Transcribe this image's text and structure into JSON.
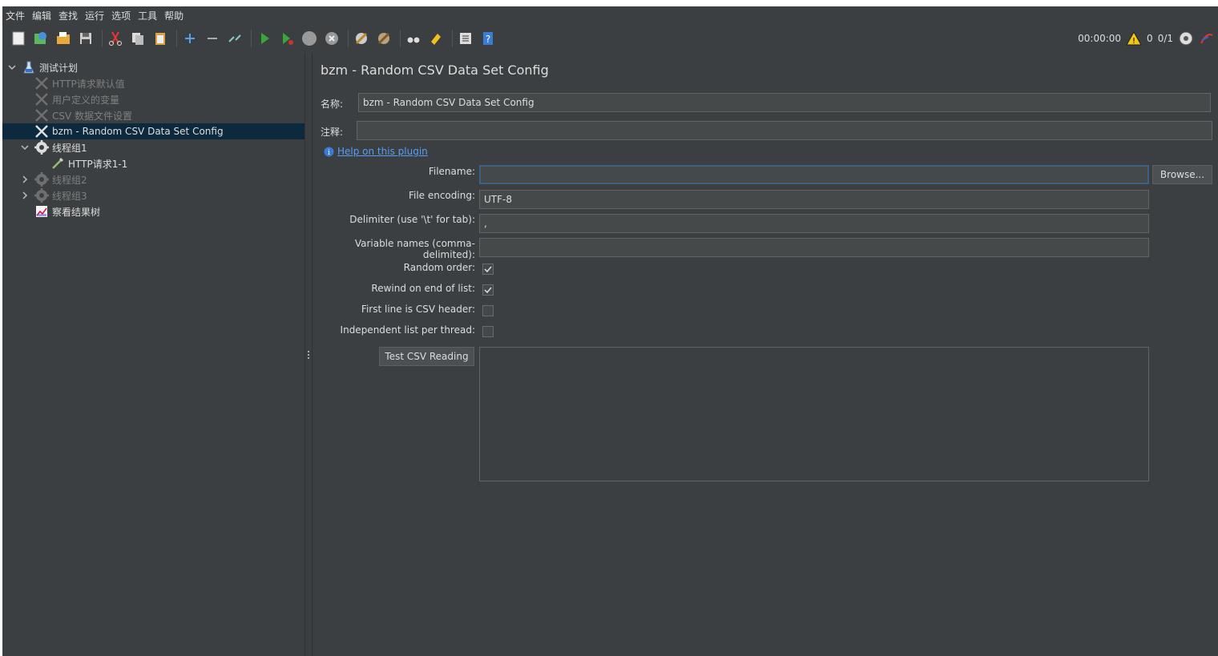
{
  "menu": [
    "文件",
    "编辑",
    "查找",
    "运行",
    "选项",
    "工具",
    "帮助"
  ],
  "toolbar_status": {
    "timer": "00:00:00",
    "warnings": "0",
    "threads": "0/1"
  },
  "tree": [
    {
      "label": "测试计划",
      "icon": "flask-icon",
      "state": "enabled",
      "level": 0,
      "expanded": true
    },
    {
      "label": "HTTP请求默认值",
      "icon": "wrench-icon",
      "state": "disabled",
      "level": 1
    },
    {
      "label": "用户定义的变量",
      "icon": "wrench-icon",
      "state": "disabled",
      "level": 1
    },
    {
      "label": "CSV 数据文件设置",
      "icon": "wrench-icon",
      "state": "disabled",
      "level": 1
    },
    {
      "label": "bzm - Random CSV Data Set Config",
      "icon": "wrench-icon",
      "state": "selected",
      "level": 1
    },
    {
      "label": "线程组1",
      "icon": "gear-icon",
      "state": "enabled",
      "level": 1,
      "expanded": true
    },
    {
      "label": "HTTP请求1-1",
      "icon": "pipette-icon",
      "state": "enabled",
      "level": 2
    },
    {
      "label": "线程组2",
      "icon": "gear-icon",
      "state": "disabled",
      "level": 1,
      "expanded": false
    },
    {
      "label": "线程组3",
      "icon": "gear-icon",
      "state": "disabled",
      "level": 1,
      "expanded": false
    },
    {
      "label": "察看结果树",
      "icon": "chart-icon",
      "state": "enabled",
      "level": 1
    }
  ],
  "panel": {
    "title": "bzm - Random CSV Data Set Config",
    "name_label": "名称:",
    "name_value": "bzm - Random CSV Data Set Config",
    "comment_label": "注释:",
    "comment_value": "",
    "help_link": "Help on this plugin",
    "filename_label": "Filename:",
    "filename_value": "",
    "browse_label": "Browse...",
    "encoding_label": "File encoding:",
    "encoding_value": "UTF-8",
    "delimiter_label": "Delimiter (use '\\t' for tab):",
    "delimiter_value": ",",
    "varnames_label": "Variable names (comma-delimited):",
    "varnames_value": "",
    "random_order_label": "Random order:",
    "random_order": true,
    "rewind_label": "Rewind on end of list:",
    "rewind": true,
    "first_line_label": "First line is CSV header:",
    "first_line": false,
    "independent_label": "Independent list per thread:",
    "independent": false,
    "test_button": "Test CSV Reading"
  }
}
